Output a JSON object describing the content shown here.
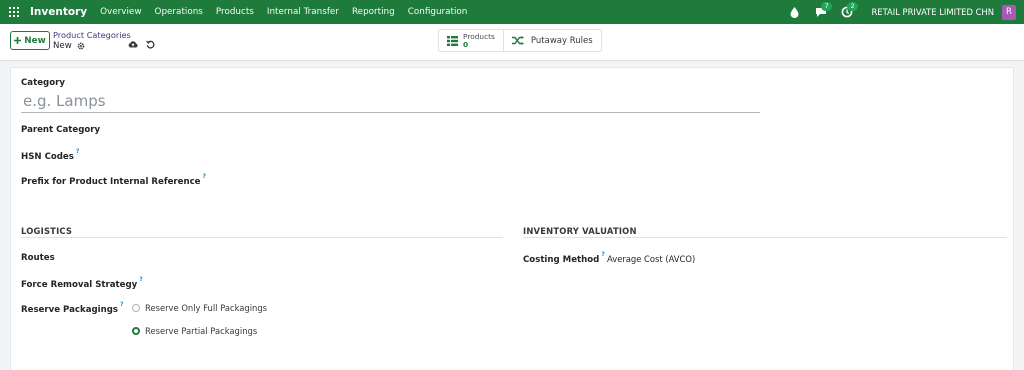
{
  "navbar": {
    "brand": "Inventory",
    "menu": [
      "Overview",
      "Operations",
      "Products",
      "Internal Transfer",
      "Reporting",
      "Configuration"
    ],
    "messages_count": "7",
    "activities_count": "2",
    "company": "RETAIL PRIVATE LIMITED CHN",
    "avatar_letter": "R",
    "brand_color": "#1e7b3c"
  },
  "control": {
    "new_label": "New",
    "breadcrumb": "Product Categories",
    "record_name": "New",
    "stat_products_label": "Products",
    "stat_products_value": "0",
    "stat_putaway_label": "Putaway Rules"
  },
  "form": {
    "category_label": "Category",
    "category_placeholder": "e.g. Lamps",
    "parent_label": "Parent Category",
    "hsn_label": "HSN Codes",
    "prefix_label": "Prefix for Product Internal Reference",
    "help_mark": "?",
    "logistics": {
      "title": "LOGISTICS",
      "routes_label": "Routes",
      "removal_label": "Force Removal Strategy",
      "packaging_label": "Reserve Packagings",
      "options": [
        {
          "label": "Reserve Only Full Packagings",
          "selected": false
        },
        {
          "label": "Reserve Partial Packagings",
          "selected": true
        }
      ]
    },
    "valuation": {
      "title": "INVENTORY VALUATION",
      "costing_label": "Costing Method",
      "costing_value": "Average Cost (AVCO)"
    }
  }
}
